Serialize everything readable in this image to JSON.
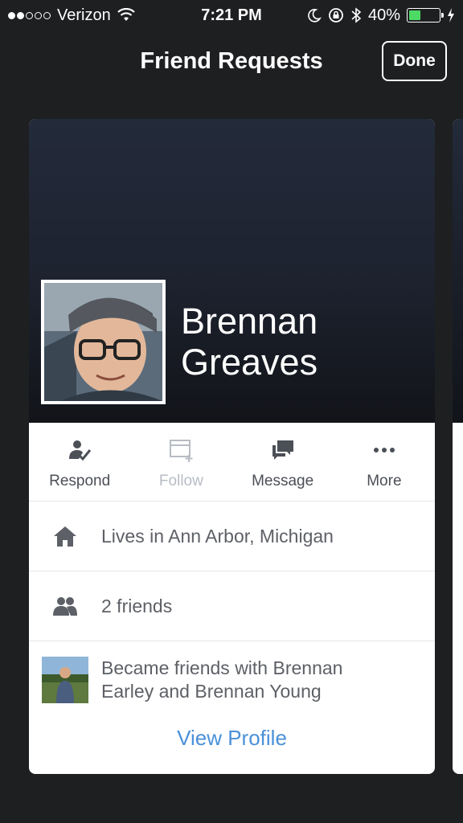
{
  "status_bar": {
    "carrier": "Verizon",
    "time": "7:21 PM",
    "battery": "40%",
    "battery_level": 0.4,
    "signal_bars_filled": 2,
    "signal_bars_total": 5
  },
  "nav": {
    "title": "Friend Requests",
    "done_label": "Done"
  },
  "profile": {
    "first_name": "Brennan",
    "last_name": "Greaves"
  },
  "actions": [
    {
      "label": "Respond",
      "icon": "respond-icon",
      "enabled": true
    },
    {
      "label": "Follow",
      "icon": "follow-icon",
      "enabled": false
    },
    {
      "label": "Message",
      "icon": "message-icon",
      "enabled": true
    },
    {
      "label": "More",
      "icon": "more-icon",
      "enabled": true
    }
  ],
  "info": {
    "lives_in": "Lives in Ann Arbor, Michigan",
    "friends": "2 friends",
    "recent_activity_line1": "Became friends with Brennan",
    "recent_activity_line2": "Earley and Brennan Young"
  },
  "view_profile_label": "View Profile",
  "colors": {
    "background": "#1e1f21",
    "link_blue": "#4a90d9",
    "battery_green": "#4cd964"
  }
}
